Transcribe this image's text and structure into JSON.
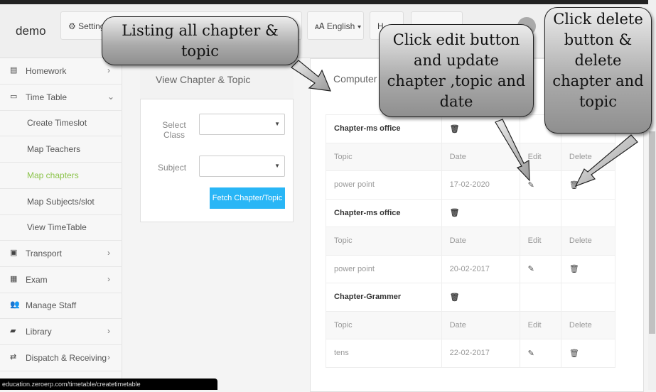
{
  "header": {
    "brand": "demo",
    "settings": "Settings",
    "language": "English ▾",
    "help": "H"
  },
  "sidebar": {
    "items": [
      {
        "label": "Homework",
        "icon": "file-icon",
        "chev": "›"
      },
      {
        "label": "Time Table",
        "icon": "calendar-icon",
        "chev": "⌄"
      },
      {
        "label": "Create Timeslot",
        "sub": true
      },
      {
        "label": "Map Teachers",
        "sub": true
      },
      {
        "label": "Map chapters",
        "sub": true,
        "active": true
      },
      {
        "label": "Map Subjects/slot",
        "sub": true
      },
      {
        "label": "View TimeTable",
        "sub": true
      },
      {
        "label": "Transport",
        "icon": "bus-icon",
        "chev": "›"
      },
      {
        "label": "Exam",
        "icon": "document-icon",
        "chev": "›"
      },
      {
        "label": "Manage Staff",
        "icon": "users-icon"
      },
      {
        "label": "Library",
        "icon": "book-icon",
        "chev": "›"
      },
      {
        "label": "Dispatch & Receiving",
        "icon": "exchange-icon",
        "chev": "›"
      }
    ]
  },
  "filter": {
    "title": "View Chapter & Topic",
    "class_label": "Select Class",
    "subject_label": "Subject",
    "fetch": "Fetch Chapter/Topic"
  },
  "list": {
    "title": "Computer",
    "headers": [
      "Topic",
      "Date",
      "Edit",
      "Delete"
    ],
    "groups": [
      {
        "chapter": "Chapter-ms office",
        "rows": [
          {
            "topic": "power point",
            "date": "17-02-2020"
          }
        ]
      },
      {
        "chapter": "Chapter-ms office",
        "rows": [
          {
            "topic": "power point",
            "date": "20-02-2017"
          }
        ]
      },
      {
        "chapter": "Chapter-Grammer",
        "rows": [
          {
            "topic": "tens",
            "date": "22-02-2017"
          }
        ]
      }
    ]
  },
  "status_url": "education.zeroerp.com/timetable/createtimetable",
  "callouts": {
    "listing": "Listing all chapter & topic",
    "edit": "Click edit button and update chapter ,topic and date",
    "delete": "Click delete button & delete chapter and topic"
  },
  "colors": {
    "accent": "#29b6f6",
    "active": "#8bc34a"
  }
}
